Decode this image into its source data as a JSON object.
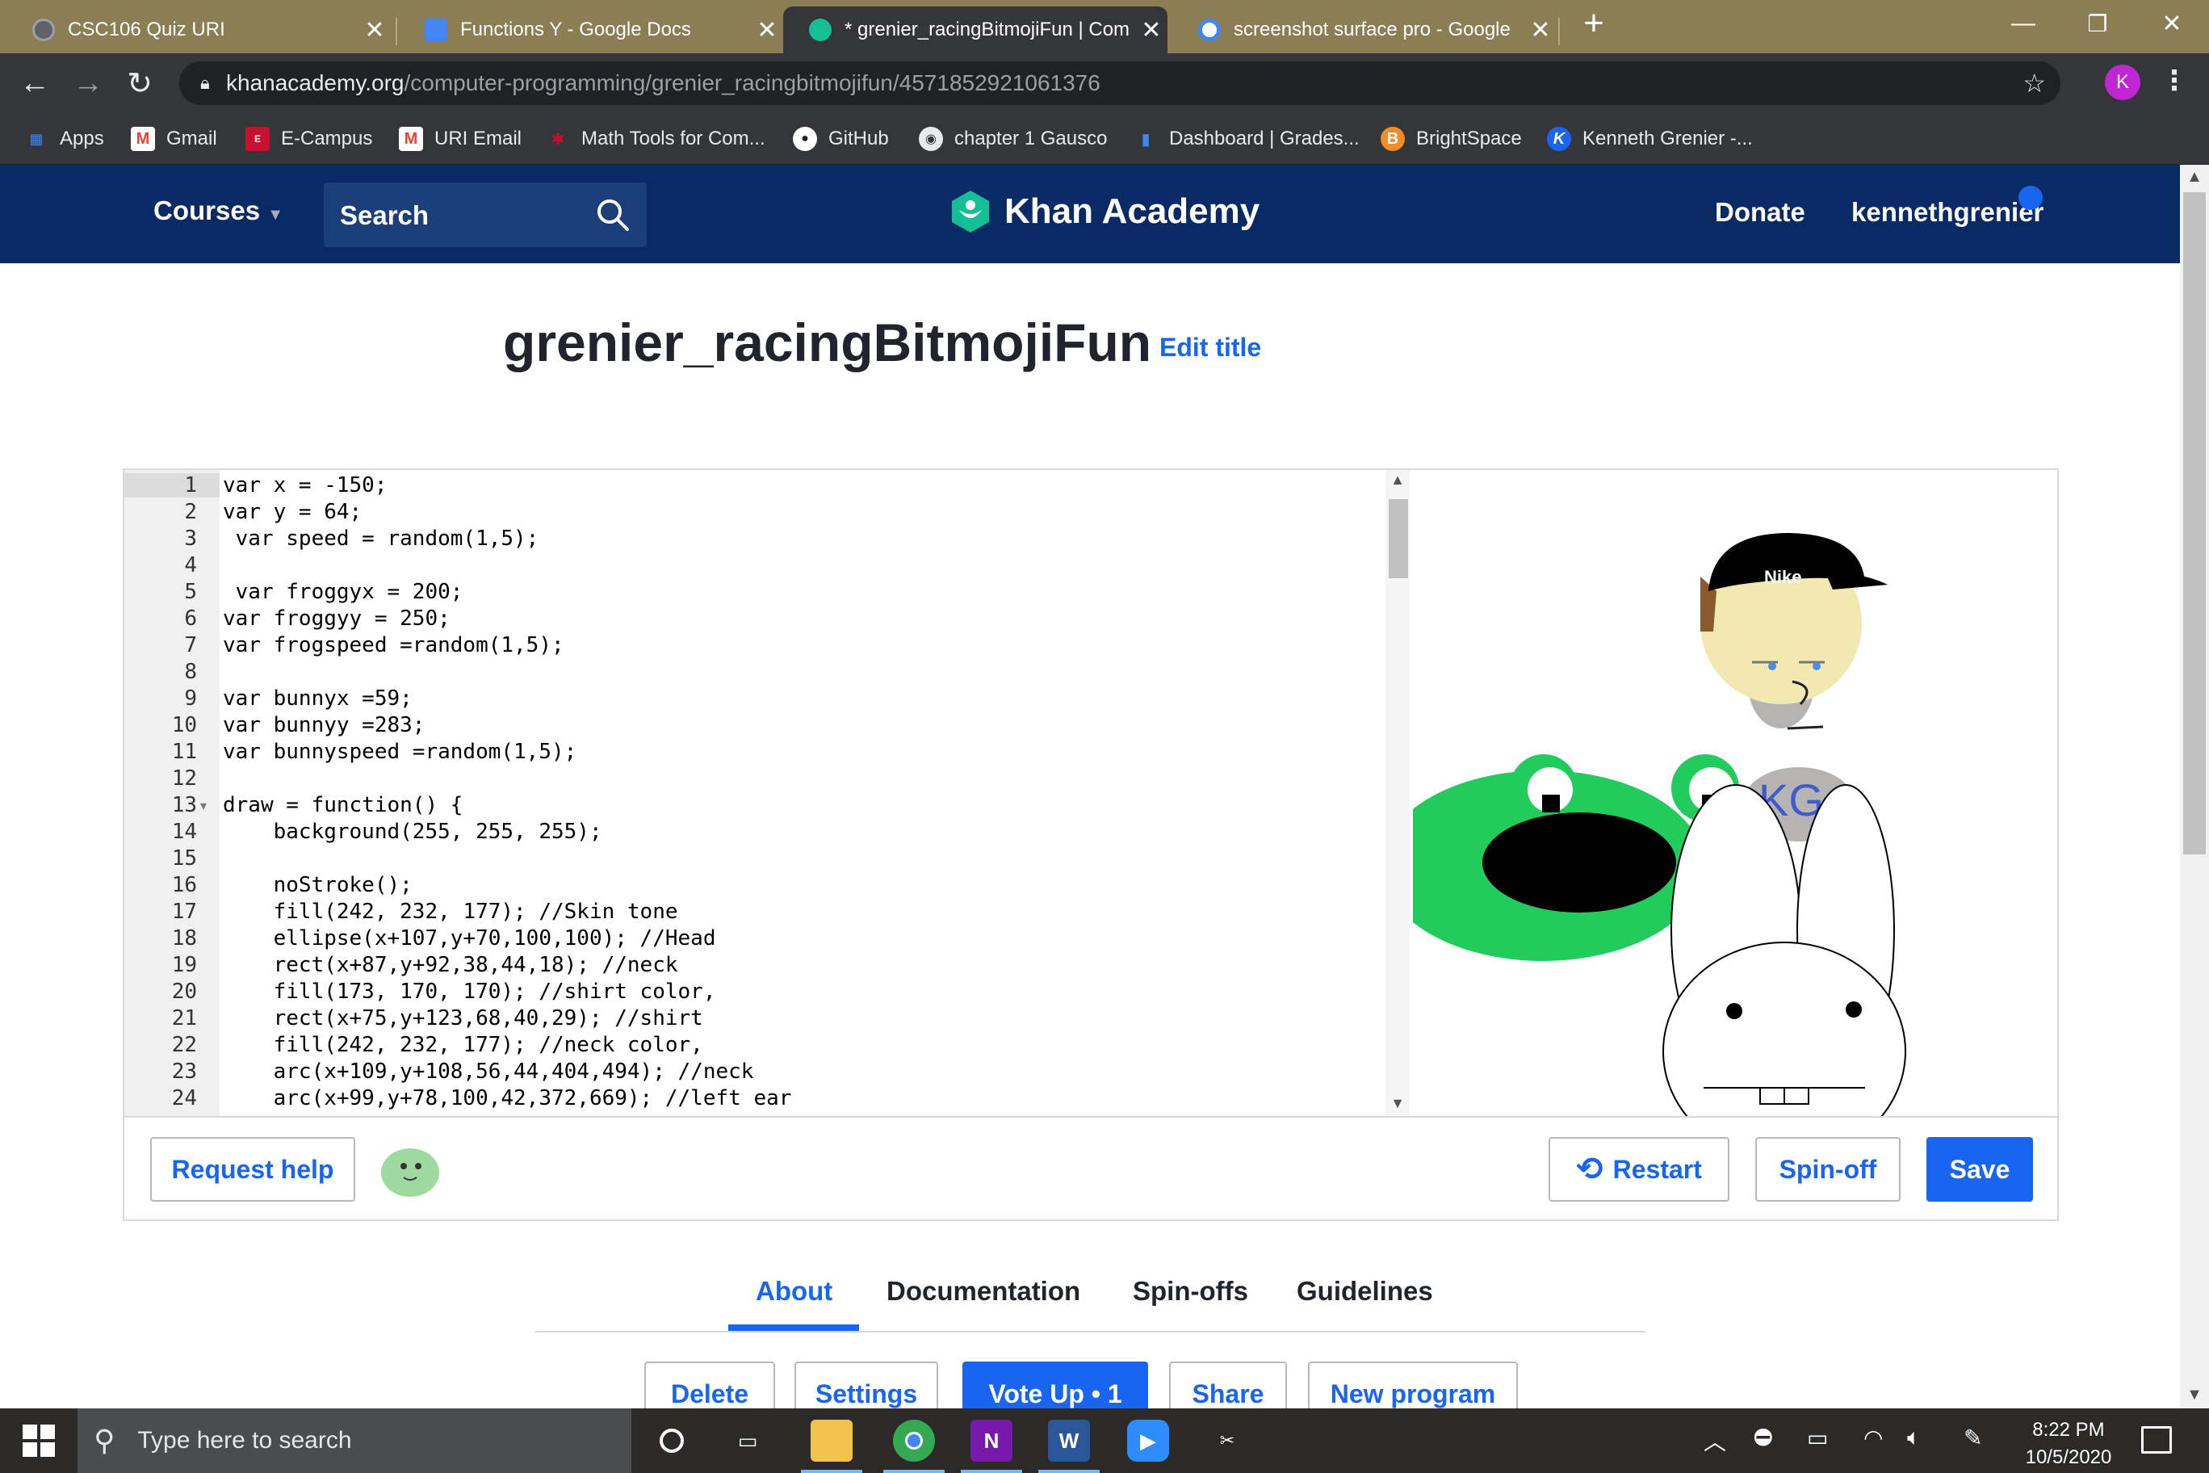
{
  "tabs": [
    {
      "title": "CSC106 Quiz URI",
      "favicon_color": "#5f6368"
    },
    {
      "title": "Functions Y - Google Docs",
      "favicon_color": "#4285f4"
    },
    {
      "title": "* grenier_racingBitmojiFun | Com",
      "favicon_color": "#14bf96"
    },
    {
      "title": "screenshot surface pro - Google",
      "favicon_color": "#ffffff"
    }
  ],
  "address": {
    "host": "khanacademy.org",
    "path": "/computer-programming/grenier_racingbitmojifun/4571852921061376"
  },
  "profile_initial": "K",
  "bookmarks": [
    {
      "label": "Apps",
      "color": "#4285f4",
      "glyph": "⋮⋮"
    },
    {
      "label": "Gmail",
      "color": "#ea4335",
      "glyph": "M"
    },
    {
      "label": "E-Campus",
      "color": "#c8102e",
      "glyph": "E"
    },
    {
      "label": "URI Email",
      "color": "#ea4335",
      "glyph": "M"
    },
    {
      "label": "Math Tools for Com...",
      "color": "#c8102e",
      "glyph": "M"
    },
    {
      "label": "GitHub",
      "color": "#ffffff",
      "glyph": "●"
    },
    {
      "label": "chapter 1 Gausco",
      "color": "#e8eaed",
      "glyph": "◉"
    },
    {
      "label": "Dashboard | Grades...",
      "color": "#4285f4",
      "glyph": "ıl"
    },
    {
      "label": "BrightSpace",
      "color": "#f28c28",
      "glyph": "B"
    },
    {
      "label": "Kenneth Grenier -...",
      "color": "#1865f2",
      "glyph": "K"
    }
  ],
  "ka": {
    "courses": "Courses",
    "search": "Search",
    "logo_text": "Khan Academy",
    "donate": "Donate",
    "username": "kennethgrenier",
    "brand_color": "#0a2a66",
    "accent": "#1865f2"
  },
  "program": {
    "title": "grenier_racingBitmojiFun",
    "edit_title": "Edit title"
  },
  "code_lines": [
    "var x = -150;",
    "var y = 64;",
    " var speed = random(1,5);",
    "",
    " var froggyx = 200;",
    "var froggyy = 250;",
    "var frogspeed =random(1,5);",
    "",
    "var bunnyx =59;",
    "var bunnyy =283;",
    "var bunnyspeed =random(1,5);",
    "",
    "draw = function() {",
    "    background(255, 255, 255);",
    "",
    "    noStroke();",
    "    fill(242, 232, 177); //Skin tone",
    "    ellipse(x+107,y+70,100,100); //Head",
    "    rect(x+87,y+92,38,44,18); //neck",
    "    fill(173, 170, 170); //shirt color,",
    "    rect(x+75,y+123,68,40,29); //shirt",
    "    fill(242, 232, 177); //neck color,",
    "    arc(x+109,y+108,56,44,404,494); //neck",
    "    arc(x+99,y+78,100,42,372,669); //left ear"
  ],
  "canvas": {
    "cap_text": "Nike",
    "shirt_text": "KG"
  },
  "editor_buttons": {
    "request_help": "Request help",
    "restart": "Restart",
    "spinoff": "Spin-off",
    "save": "Save"
  },
  "page_tabs": [
    "About",
    "Documentation",
    "Spin-offs",
    "Guidelines"
  ],
  "actions": {
    "delete": "Delete",
    "settings": "Settings",
    "vote_up": "Vote Up • 1",
    "share": "Share",
    "new_program": "New program"
  },
  "taskbar": {
    "search_placeholder": "Type here to search",
    "time": "8:22 PM",
    "date": "10/5/2020"
  }
}
